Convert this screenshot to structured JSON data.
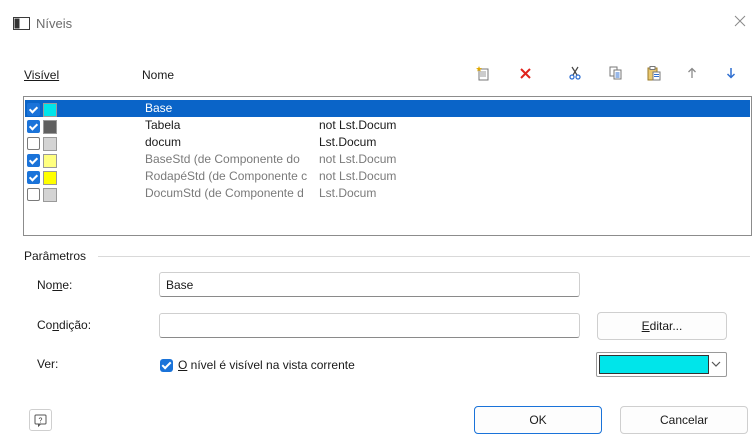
{
  "window": {
    "title": "Níveis"
  },
  "list": {
    "headers": {
      "visible": "Visível",
      "name": "Nome"
    },
    "rows": [
      {
        "name": "Base",
        "condition": "",
        "checked": true,
        "color": "#00e5ea",
        "selected": true,
        "gray": false
      },
      {
        "name": "Tabela",
        "condition": "not Lst.Docum",
        "checked": true,
        "color": "#606060",
        "selected": false,
        "gray": false
      },
      {
        "name": "docum",
        "condition": "Lst.Docum",
        "checked": false,
        "color": "#d4d4d4",
        "selected": false,
        "gray": false
      },
      {
        "name": "BaseStd (de Componente do",
        "condition": "not Lst.Docum",
        "checked": true,
        "color": "#ffff80",
        "selected": false,
        "gray": true
      },
      {
        "name": "RodapéStd (de Componente c",
        "condition": "not Lst.Docum",
        "checked": true,
        "color": "#ffff00",
        "selected": false,
        "gray": true
      },
      {
        "name": "DocumStd (de Componente d",
        "condition": "Lst.Docum",
        "checked": false,
        "color": "#d4d4d4",
        "selected": false,
        "gray": true
      }
    ]
  },
  "toolbar": {
    "icons": [
      "new-level-icon",
      "delete-icon",
      "cut-icon",
      "copy-icon",
      "paste-icon",
      "move-up-icon",
      "move-down-icon"
    ],
    "delete_color": "#e0231c",
    "arrow_color": "#2f6fd1"
  },
  "params": {
    "section_label": "Parâmetros",
    "name_label_pre": "No",
    "name_label_u": "m",
    "name_label_post": "e:",
    "name_value": "Base",
    "cond_label_pre": "Co",
    "cond_label_u": "n",
    "cond_label_post": "dição:",
    "cond_value": "",
    "edit_button_u": "E",
    "edit_button_rest": "ditar...",
    "view_label": "Ver:",
    "visible_u": "O",
    "visible_rest": " nível é visível na vista corrente",
    "visible_checked": true,
    "color": "#00e5ea"
  },
  "footer": {
    "ok": "OK",
    "cancel": "Cancelar"
  }
}
